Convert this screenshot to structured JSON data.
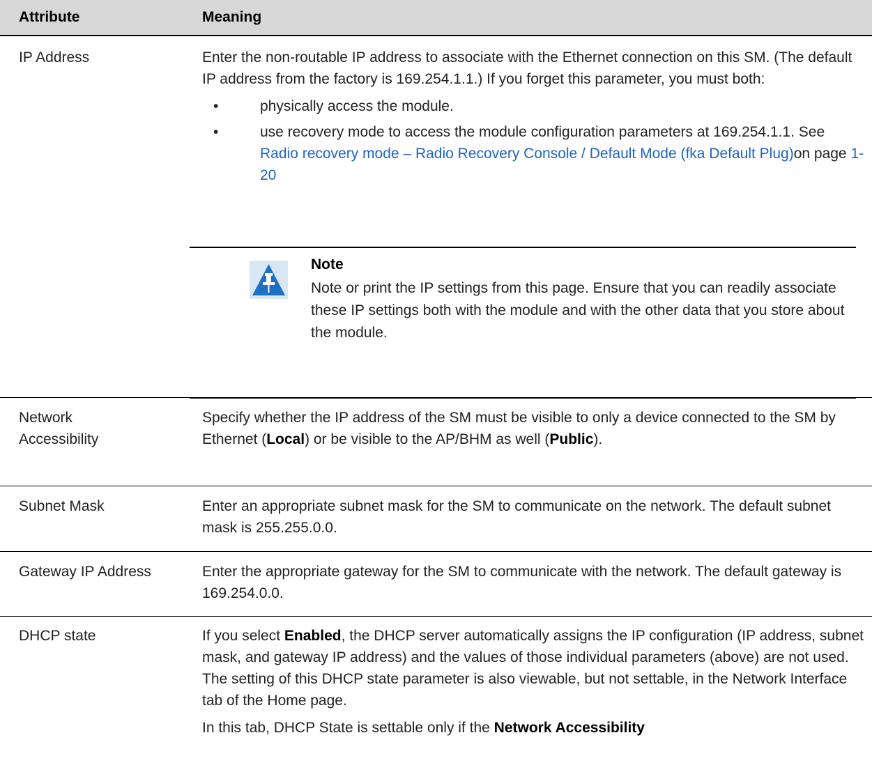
{
  "header": {
    "col_attribute": "Attribute",
    "col_meaning": "Meaning"
  },
  "rows": {
    "ip_address": {
      "attribute": "IP Address",
      "intro": "Enter the non-routable IP address to associate with the Ethernet connection on this SM. (The default IP address from the factory is 169.254.1.1.) If you forget this parameter, you must both:",
      "bullet1": "physically access the module.",
      "bullet2_prefix": "use recovery mode to access the module configuration parameters at 169.254.1.1. See ",
      "bullet2_link": "Radio recovery mode – Radio Recovery Console / Default Mode (fka Default Plug)",
      "bullet2_mid": "on page ",
      "bullet2_page": "1-20",
      "note_title": "Note",
      "note_body": "Note or print the IP settings from this page. Ensure that you can readily associate these IP settings both with the module and with the other data that you store about the module."
    },
    "network_accessibility": {
      "attribute_line1": "Network",
      "attribute_line2": "Accessibility",
      "m1": "Specify whether the IP address of the SM must be visible to only a device connected to the SM by Ethernet (",
      "m1_bold": "Local",
      "m2": ") or be visible to the AP/BHM as well (",
      "m2_bold": "Public",
      "m3": ")."
    },
    "subnet_mask": {
      "attribute": "Subnet Mask",
      "meaning": "Enter an appropriate subnet mask for the SM to communicate on the network. The default subnet mask is 255.255.0.0."
    },
    "gateway": {
      "attribute": "Gateway IP Address",
      "meaning": "Enter the appropriate gateway for the SM to communicate with the network. The default gateway is 169.254.0.0."
    },
    "dhcp_state": {
      "attribute": "DHCP state",
      "p1_a": "If you select ",
      "p1_bold": "Enabled",
      "p1_b": ", the DHCP server automatically assigns the IP configuration (IP address, subnet mask, and gateway IP address) and the values of those individual parameters (above) are not used. The setting of this DHCP state parameter is also viewable, but not settable, in the Network Interface tab of the Home page.",
      "p2_a": "In this tab, DHCP State is settable only if the ",
      "p2_bold": "Network Accessibility"
    }
  }
}
